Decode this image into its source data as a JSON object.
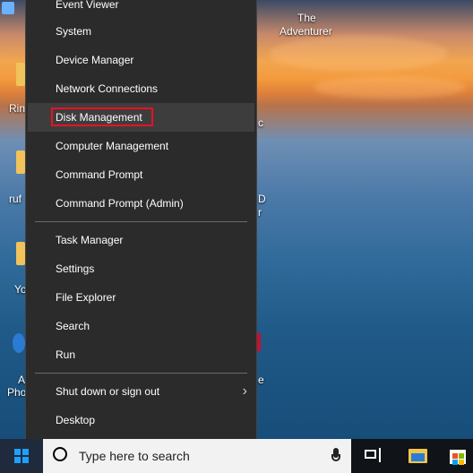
{
  "desktop": {
    "icon_labels": [
      "The",
      "Adventurer"
    ],
    "partial_labels": [
      "Rin",
      "ruf",
      "Yo",
      "A",
      "Pho",
      "c",
      "D",
      "r",
      "e"
    ]
  },
  "menu": {
    "items": [
      {
        "label": "Event Viewer"
      },
      {
        "label": "System"
      },
      {
        "label": "Device Manager"
      },
      {
        "label": "Network Connections"
      },
      {
        "label": "Disk Management"
      },
      {
        "label": "Computer Management"
      },
      {
        "label": "Command Prompt"
      },
      {
        "label": "Command Prompt (Admin)"
      },
      {
        "label": "Task Manager"
      },
      {
        "label": "Settings"
      },
      {
        "label": "File Explorer"
      },
      {
        "label": "Search"
      },
      {
        "label": "Run"
      },
      {
        "label": "Shut down or sign out"
      },
      {
        "label": "Desktop"
      }
    ],
    "arrow": "›"
  },
  "taskbar": {
    "search_placeholder": "Type here to search"
  },
  "colors": {
    "menu_bg": "#2b2b2b",
    "highlight": "#e81123",
    "start_accent": "#1ea0ff"
  }
}
